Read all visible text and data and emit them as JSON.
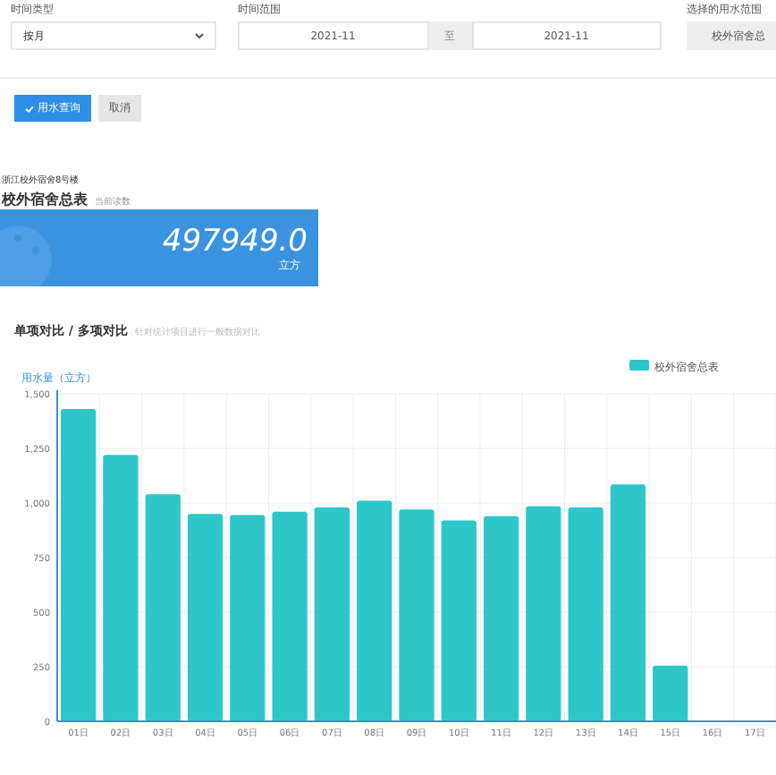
{
  "filters": {
    "time_type": {
      "label": "时间类型",
      "value": "按月"
    },
    "time_range": {
      "label": "时间范围",
      "start": "2021-11",
      "separator": "至",
      "end": "2021-11"
    },
    "water_scope": {
      "label": "选择的用水范围",
      "value": "校外宿舍总"
    }
  },
  "buttons": [
    {
      "label": "用水查询",
      "kind": "primary"
    },
    {
      "label": "取消",
      "kind": "default"
    }
  ],
  "meter": {
    "caption": "浙江校外宿舍8号楼",
    "title": "校外宿舍总表",
    "subtitle": "当前读数",
    "reading": "497949.0",
    "unit": "立方"
  },
  "comparison": {
    "title": "单项对比 / 多项对比",
    "hint": "针对统计项目进行一般数据对比",
    "chart_data": {
      "type": "bar",
      "ylabel": "用水量（立方）",
      "categories": [
        "01日",
        "02日",
        "03日",
        "04日",
        "05日",
        "06日",
        "07日",
        "08日",
        "09日",
        "10日",
        "11日",
        "12日",
        "13日",
        "14日",
        "15日",
        "16日",
        "17日"
      ],
      "series": [
        {
          "name": "校外宿舍总表",
          "color": "#2ec7c9",
          "values": [
            1430,
            1220,
            1040,
            950,
            945,
            960,
            980,
            1010,
            970,
            920,
            940,
            985,
            980,
            1085,
            255,
            null,
            null
          ]
        }
      ],
      "grid": true,
      "ylim": [
        0,
        1500
      ],
      "yticks": [
        {
          "value": 0,
          "label": "0"
        },
        {
          "value": 250,
          "label": "250"
        },
        {
          "value": 500,
          "label": "500"
        },
        {
          "value": 750,
          "label": "750"
        },
        {
          "value": 1000,
          "label": "1,000"
        },
        {
          "value": 1250,
          "label": "1,250"
        },
        {
          "value": 1500,
          "label": "1,500"
        }
      ]
    }
  }
}
